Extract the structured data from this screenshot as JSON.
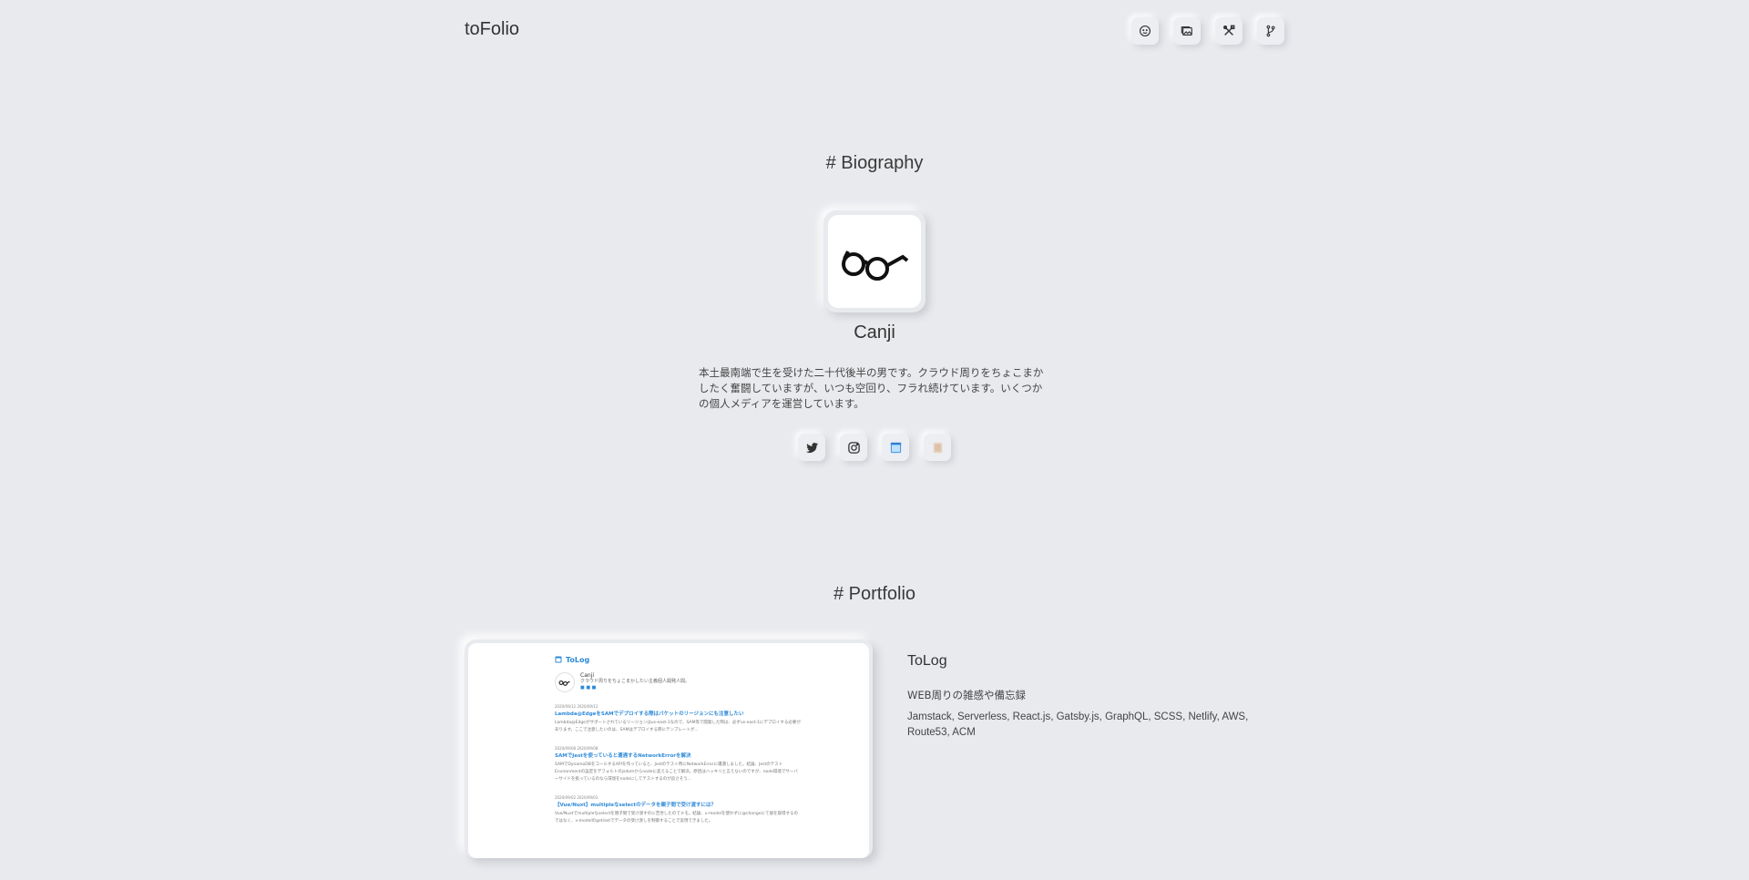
{
  "header": {
    "brand": "toFolio",
    "nav": [
      {
        "icon": "smile-icon"
      },
      {
        "icon": "gallery-icon"
      },
      {
        "icon": "tools-icon"
      },
      {
        "icon": "git-branch-icon"
      }
    ]
  },
  "biography": {
    "title": "# Biography",
    "name": "Canji",
    "bio": "本土最南端で生を受けた二十代後半の男です。クラウド周りをちょこまかしたく奮闘していますが、いつも空回り、フラれ続けています。いくつかの個人メディアを運営しています。",
    "social": [
      {
        "icon": "twitter-icon"
      },
      {
        "icon": "instagram-icon"
      },
      {
        "icon": "blog-icon"
      },
      {
        "icon": "note-icon"
      }
    ]
  },
  "portfolio": {
    "title": "# Portfolio",
    "items": [
      {
        "name": "ToLog",
        "description": "WEB周りの雑感や備忘録",
        "tech": "Jamstack, Serverless, React.js, Gatsby.js, GraphQL, SCSS, Netlify, AWS, Route53, ACM",
        "screenshot": {
          "logo": "ToLog",
          "author": "Canji",
          "tagline": "クラウド周りをちょこまかしたい主義個人開発人間。",
          "posts": [
            {
              "date": "2020/09/12   2020/09/12",
              "title": "Lambda@EdgeをSAMでデプロイする際はバケットのリージョンにも注意したい",
              "body": "Lambda@Edgeがサポートされているリージョンはus-east-1なので、SAM等で開発した際は、必ずus-east-1にデプロイする必要があります。ここで注意したいのは、SAMはデプロイする際にテンプレートが..."
            },
            {
              "date": "2020/09/08   2020/09/08",
              "title": "SAMでJestを使っていると遭遇するNetworkErrorを解決",
              "body": "SAMでDynamoDBをコールするAPIを作っていると、Jestのテスト時にNetworkErrorに遭遇しました。結論、JestのテストEnvironmentの設定をデフォルトのjsdomからnodeに変えることで解決。原因はハッキリと言えないのですが、node環境でサーバーサイドを扱っているのなら環境をnodeにしてテストするのが良さそう..."
            },
            {
              "date": "2020/09/02   2020/09/03",
              "title": "【Vue/Nuxt】multipleなselectのデータを親子間で受け渡すには？",
              "body": "Vue/Nuxtでmultipleなselectを親子間で受け渡すのに苦労したのでメモ。結論、v-modelを使わずに@changeにて値を取得するのではなく、v-modelのget/setでデータの受け渡しを制御することで実現できました。"
            }
          ]
        }
      }
    ]
  }
}
